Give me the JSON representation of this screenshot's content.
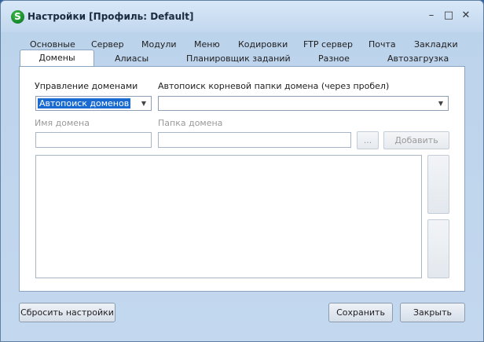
{
  "window": {
    "title": "Настройки [Профиль: Default]",
    "icon_letter": "S",
    "controls": {
      "minimize": "–",
      "maximize": "□",
      "close": "✕"
    }
  },
  "tabs": {
    "row1": [
      "Основные",
      "Сервер",
      "Модули",
      "Меню",
      "Кодировки",
      "FTP сервер",
      "Почта",
      "Закладки"
    ],
    "row2": [
      "Домены",
      "Алиасы",
      "Планировщик заданий",
      "Разное",
      "Автозагрузка"
    ],
    "active": "Домены"
  },
  "domains": {
    "management_label": "Управление доменами",
    "management_value": "Автопоиск доменов",
    "autosearch_label": "Автопоиск корневой папки домена (через пробел)",
    "autosearch_value": "",
    "domain_name_label": "Имя домена",
    "domain_name_value": "",
    "domain_folder_label": "Папка домена",
    "domain_folder_value": "",
    "browse_label": "...",
    "add_label": "Добавить",
    "list_items": []
  },
  "footer": {
    "reset_label": "Сбросить настройки",
    "save_label": "Сохранить",
    "close_label": "Закрыть"
  }
}
